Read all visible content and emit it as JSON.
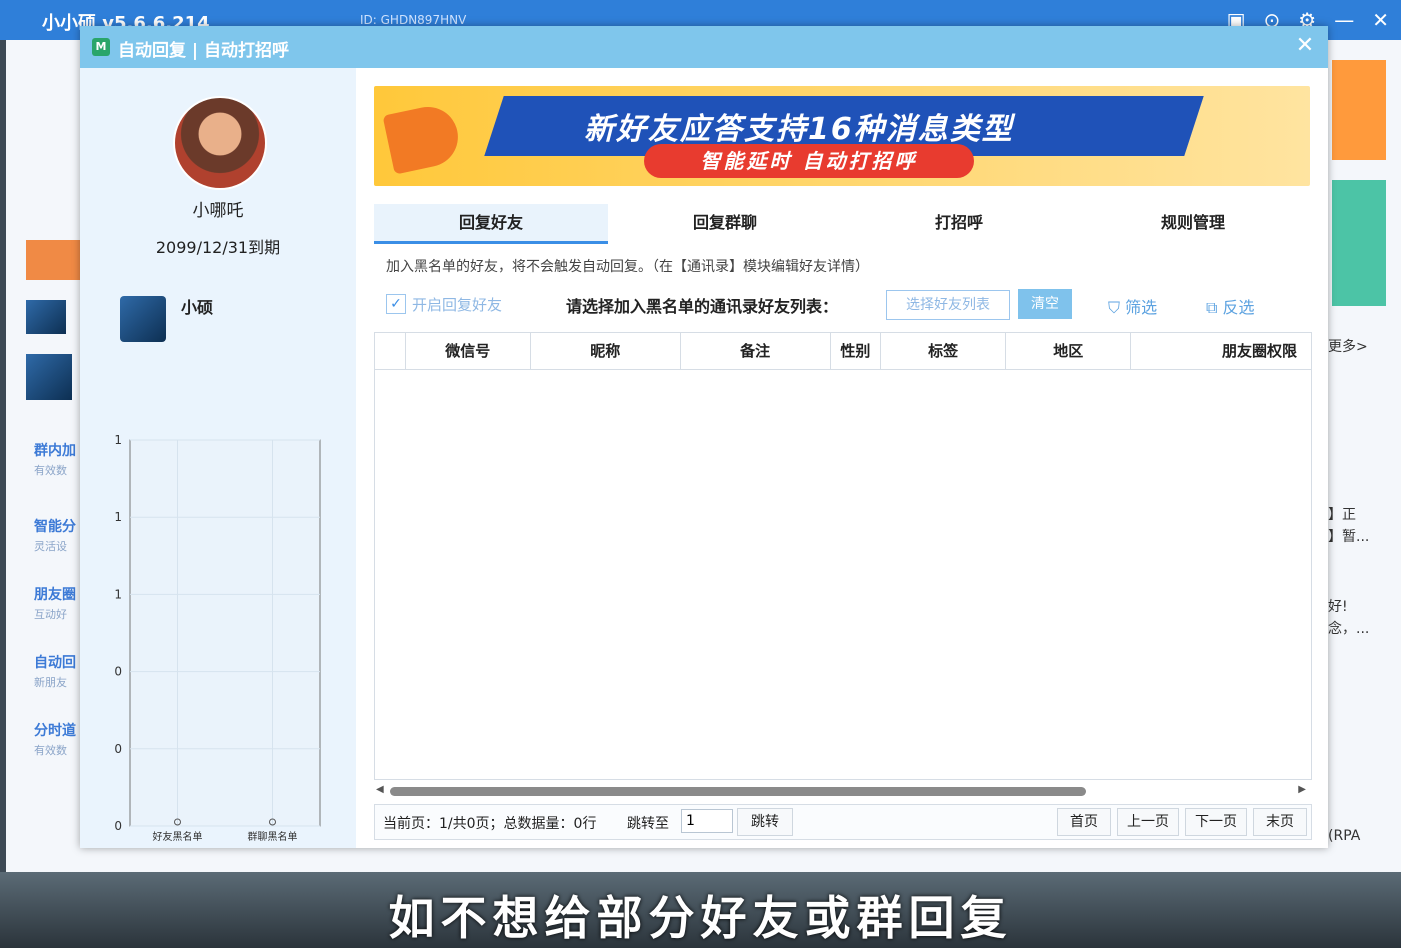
{
  "background_app": {
    "title": "小小硕 v5.6.6.214",
    "id_text": "ID: GHDN897HNV",
    "left_items": [
      {
        "label": "群内加",
        "sub": "有效数"
      },
      {
        "label": "智能分",
        "sub": "灵活设"
      },
      {
        "label": "朋友圈",
        "sub": "互动好"
      },
      {
        "label": "自动回",
        "sub": "新朋友"
      },
      {
        "label": "分时道",
        "sub": "有效数"
      }
    ],
    "right_texts": [
      "更多>",
      "】正",
      "】暂...",
      "好!",
      "念，...",
      "(RPA"
    ],
    "subtitle": "如不想给部分好友或群回复"
  },
  "dialog": {
    "title": "自动回复 | 自动打招呼",
    "close_glyph": "✕"
  },
  "user": {
    "name": "小哪吒",
    "expire": "2099/12/31到期",
    "account_name": "小硕"
  },
  "mini_chart": {
    "chart_data": {
      "type": "bar",
      "categories": [
        "好友黑名单",
        "群聊黑名单"
      ],
      "values": [
        0,
        0
      ],
      "y_ticks": [
        "1",
        "1",
        "1",
        "0",
        "0",
        "0"
      ]
    }
  },
  "banner": {
    "title": "新好友应答支持16种消息类型",
    "subtitle": "智能延时 自动打招呼"
  },
  "tabs": [
    {
      "label": "回复好友",
      "active": true
    },
    {
      "label": "回复群聊",
      "active": false
    },
    {
      "label": "打招呼",
      "active": false
    },
    {
      "label": "规则管理",
      "active": false
    }
  ],
  "notice": "加入黑名单的好友，将不会触发自动回复。（在【通讯录】模块编辑好友详情）",
  "toolbar": {
    "checkbox_label": "开启回复好友",
    "select_label": "请选择加入黑名单的通讯录好友列表：",
    "select_button": "选择好友列表",
    "clear_button": "清空",
    "filter_button": "筛选",
    "invert_button": "反选"
  },
  "table": {
    "columns": [
      "",
      "微信号",
      "昵称",
      "备注",
      "性别",
      "标签",
      "地区",
      "朋友圈权限"
    ]
  },
  "pager": {
    "info": "当前页：1/共0页；总数据量：0行",
    "goto_label": "跳转至",
    "goto_value": "1",
    "goto_button": "跳转",
    "first": "首页",
    "prev": "上一页",
    "next": "下一页",
    "last": "末页"
  }
}
